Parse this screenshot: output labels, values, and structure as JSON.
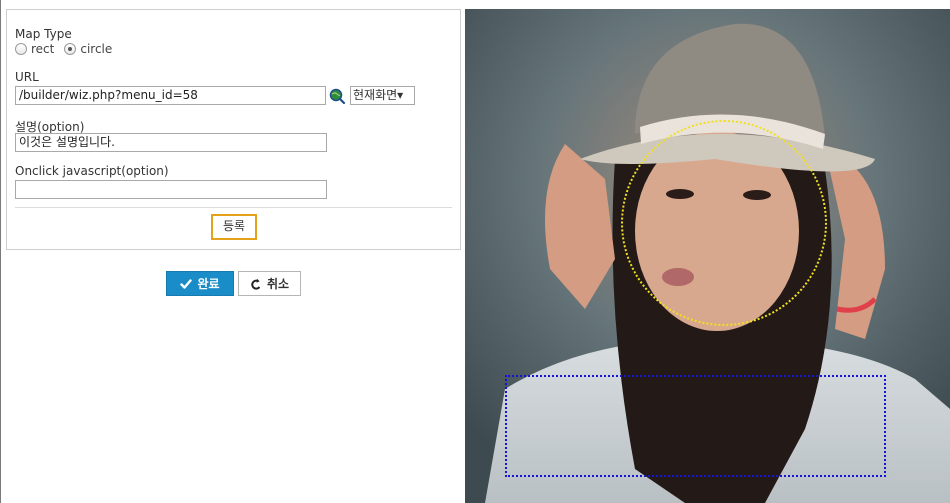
{
  "form": {
    "map_type_label": "Map Type",
    "map_type_options": [
      {
        "label": "rect",
        "selected": false
      },
      {
        "label": "circle",
        "selected": true
      }
    ],
    "url_label": "URL",
    "url_value": "/builder/wiz.php?menu_id=58",
    "target_select_value": "현재화면▾",
    "description_label": "설명(option)",
    "description_value": "이것은 설명입니다.",
    "onclick_label": "Onclick javascript(option)",
    "onclick_value": "",
    "register_button": "등록"
  },
  "actions": {
    "done_label": "완료",
    "cancel_label": "취소"
  },
  "image_map": {
    "hotspots": [
      {
        "shape": "circle",
        "color": "#f0e020"
      },
      {
        "shape": "rect",
        "color": "#1414d8"
      }
    ]
  },
  "icons": [
    "search-globe-icon",
    "check-icon",
    "undo-icon"
  ],
  "colors": {
    "accent": "#1a8cc8",
    "register_border": "#e3a21a"
  }
}
